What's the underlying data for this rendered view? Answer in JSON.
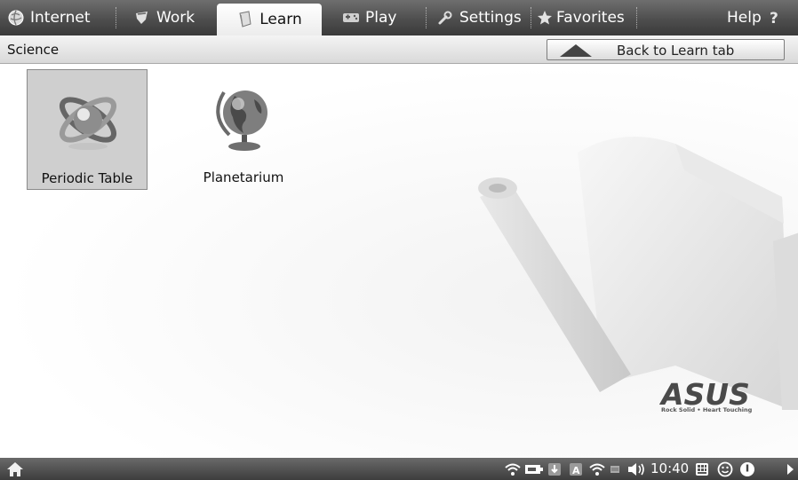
{
  "tabs": [
    {
      "label": "Internet",
      "icon": "internet-icon",
      "active": false
    },
    {
      "label": "Work",
      "icon": "work-icon",
      "active": false
    },
    {
      "label": "Learn",
      "icon": "learn-icon",
      "active": true
    },
    {
      "label": "Play",
      "icon": "play-icon",
      "active": false
    },
    {
      "label": "Settings",
      "icon": "settings-icon",
      "active": false
    },
    {
      "label": "Favorites",
      "icon": "favorites-icon",
      "active": false
    }
  ],
  "help": {
    "label": "Help",
    "icon": "help-icon"
  },
  "header": {
    "category": "Science",
    "back_label": "Back to Learn tab"
  },
  "apps": [
    {
      "label": "Periodic Table",
      "icon": "atom-icon",
      "selected": true
    },
    {
      "label": "Planetarium",
      "icon": "globe-icon",
      "selected": false
    }
  ],
  "brand": {
    "logo": "ASUS",
    "tagline": "Rock Solid • Heart Touching"
  },
  "taskbar": {
    "time": "10:40",
    "tray_icons": [
      "network-icon",
      "battery-icon",
      "update-icon",
      "keyboard-layout-icon",
      "wifi-icon",
      "storage-icon",
      "volume-icon",
      "virtual-keyboard-icon",
      "smiley-icon",
      "power-icon",
      "arrow-right-icon"
    ]
  },
  "colors": {
    "tabbar": "#4e4e4e",
    "active_tab": "#ffffff",
    "taskbar": "#4a4a4a"
  }
}
